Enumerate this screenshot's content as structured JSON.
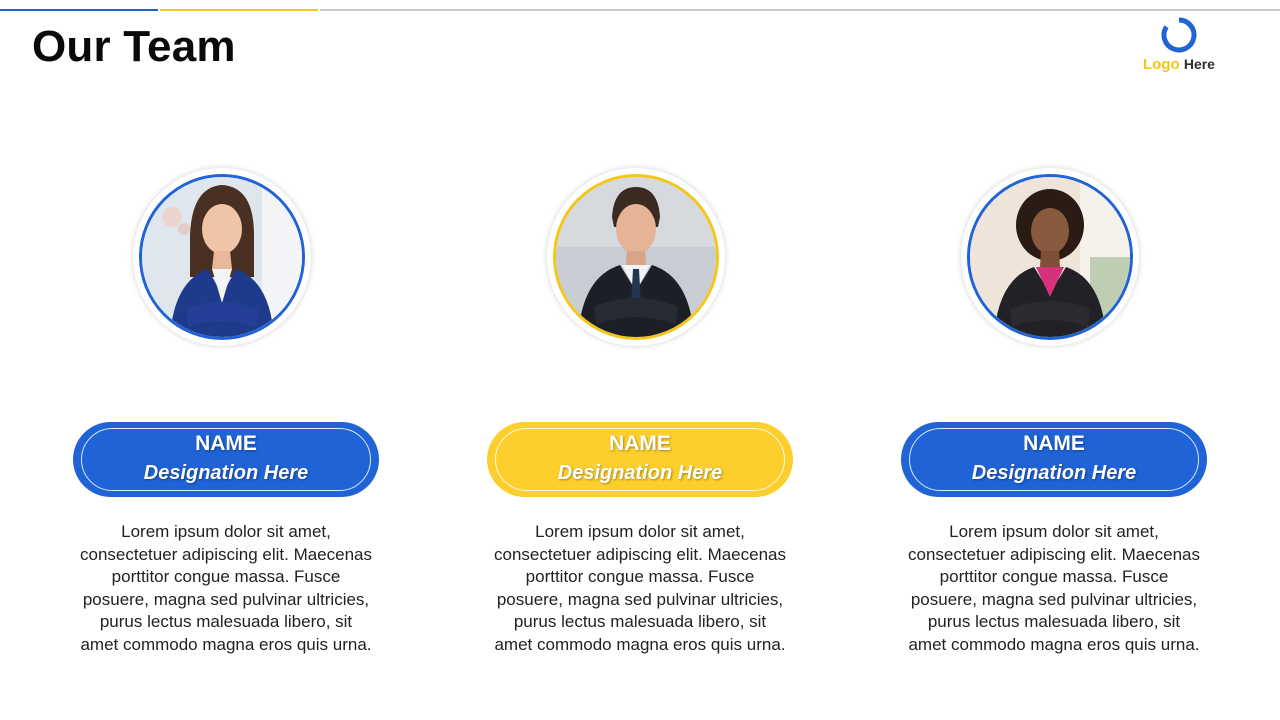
{
  "page": {
    "title": "Our Team"
  },
  "logo": {
    "word1": "Logo",
    "word2": "Here",
    "ring_color": "#1f63d6",
    "word1_color": "#f5c518"
  },
  "colors": {
    "blue": "#1f63d6",
    "yellow": "#fccf2c",
    "gray_line": "#c9c9c9"
  },
  "members": [
    {
      "name": "NAME",
      "designation": "Designation Here",
      "bio": "Lorem ipsum dolor sit amet, consectetuer adipiscing elit. Maecenas porttitor congue massa. Fusce posuere, magna sed pulvinar ultricies, purus lectus malesuada libero, sit amet commodo magna eros quis urna.",
      "accent": "#1f63d6"
    },
    {
      "name": "NAME",
      "designation": "Designation Here",
      "bio": "Lorem ipsum dolor sit amet, consectetuer adipiscing elit. Maecenas porttitor congue massa. Fusce posuere, magna sed pulvinar ultricies, purus lectus malesuada libero, sit amet commodo magna eros quis urna.",
      "accent": "#fccf2c"
    },
    {
      "name": "NAME",
      "designation": "Designation Here",
      "bio": "Lorem ipsum dolor sit amet, consectetuer adipiscing elit. Maecenas porttitor congue massa. Fusce posuere, magna sed pulvinar ultricies, purus lectus malesuada libero, sit amet commodo magna eros quis urna.",
      "accent": "#1f63d6"
    }
  ]
}
